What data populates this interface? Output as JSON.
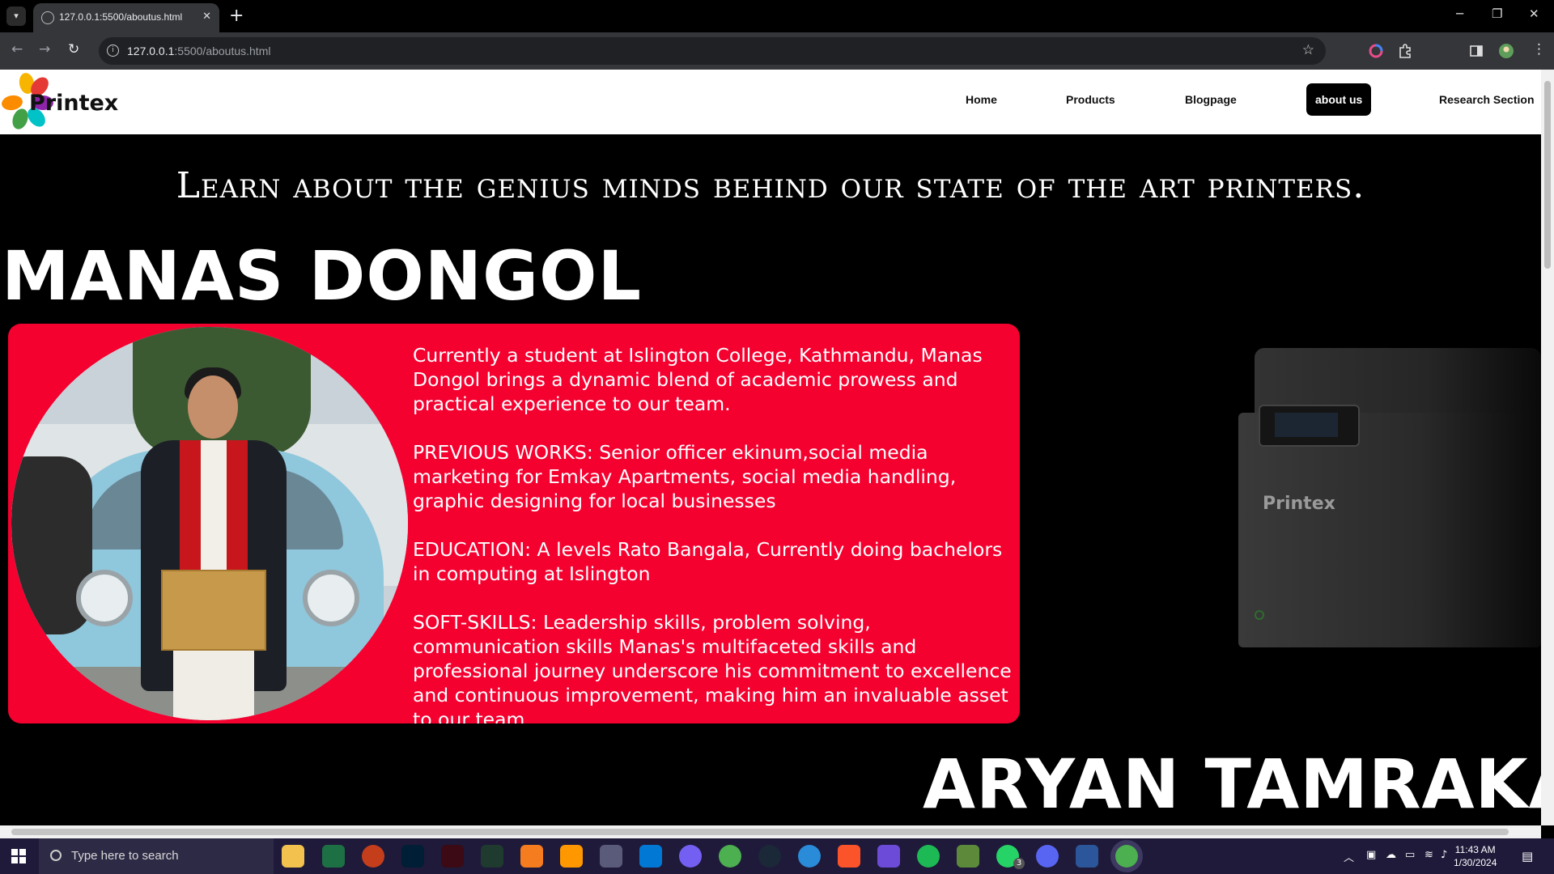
{
  "browser": {
    "tab_title": "127.0.0.1:5500/aboutus.html",
    "url_host": "127.0.0.1",
    "url_rest": ":5500/aboutus.html",
    "new_tab_label": "+",
    "tab_close": "✕"
  },
  "site": {
    "logo_text": "Printex",
    "nav": [
      {
        "label": "Home"
      },
      {
        "label": "Products"
      },
      {
        "label": "Blogpage"
      },
      {
        "label": "about us",
        "active": true
      },
      {
        "label": "Research Section"
      }
    ],
    "subtitle": "Learn about the genius minds behind our state of the art printers."
  },
  "members": [
    {
      "name": "MANAS DONGOL",
      "bio": [
        "Currently a student at Islington College, Kathmandu, Manas Dongol brings a dynamic blend of academic prowess and practical experience to our team.",
        "PREVIOUS WORKS: Senior officer ekinum,social media marketing for Emkay Apartments, social media handling, graphic designing for local businesses",
        "EDUCATION: A levels Rato Bangala, Currently doing bachelors in computing at Islington",
        "SOFT-SKILLS: Leadership skills, problem solving, communication skills Manas's multifaceted skills and professional journey underscore his commitment to excellence and continuous improvement, making him an invaluable asset to our team"
      ]
    },
    {
      "name": "ARYAN TAMRAKAR"
    }
  ],
  "printer_logo_text": "Printex",
  "taskbar": {
    "search_placeholder": "Type here to search",
    "time": "11:43 AM",
    "date": "1/30/2024",
    "whatsapp_badge": "3"
  },
  "colors": {
    "card_bg": "#f40130",
    "page_bg": "#000000",
    "navbar_bg": "#ffffff"
  }
}
